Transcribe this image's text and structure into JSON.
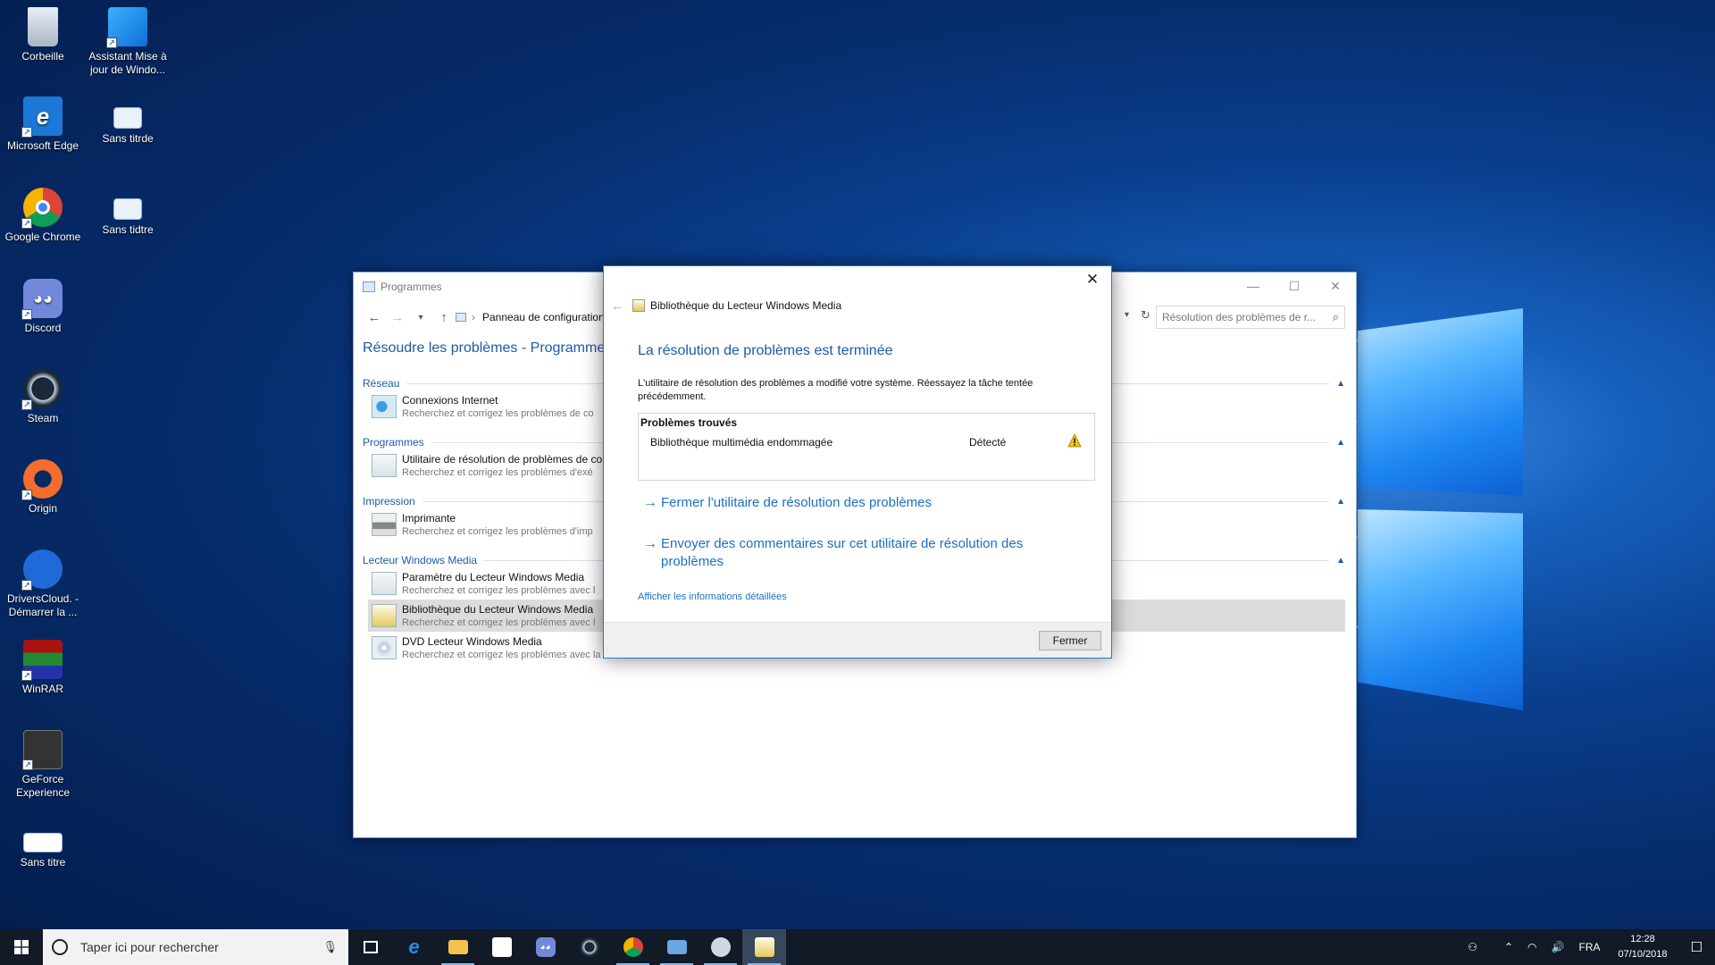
{
  "desktop": {
    "icons": [
      {
        "label": "Corbeille",
        "icon": "recycle-bin-icon"
      },
      {
        "label": "Assistant Mise à jour de Windo...",
        "icon": "windows-update-icon"
      },
      {
        "label": "Microsoft Edge",
        "icon": "edge-icon"
      },
      {
        "label": "Sans titrde",
        "icon": "image-file-icon"
      },
      {
        "label": "Google Chrome",
        "icon": "chrome-icon"
      },
      {
        "label": "Sans tidtre",
        "icon": "image-file-icon"
      },
      {
        "label": "Discord",
        "icon": "discord-icon"
      },
      {
        "label": "Steam",
        "icon": "steam-icon"
      },
      {
        "label": "Origin",
        "icon": "origin-icon"
      },
      {
        "label": "DriversCloud. - Démarrer la ...",
        "icon": "driverscloud-icon"
      },
      {
        "label": "WinRAR",
        "icon": "winrar-icon"
      },
      {
        "label": "GeForce Experience",
        "icon": "geforce-icon"
      },
      {
        "label": "Sans titre",
        "icon": "image-file-icon"
      }
    ]
  },
  "programs_window": {
    "title": "Programmes",
    "address": "Panneau de configuration",
    "search_placeholder": "Résolution des problèmes de r...",
    "heading": "Résoudre les problèmes - Programmes",
    "sections": [
      {
        "name": "Réseau",
        "items": [
          {
            "title": "Connexions Internet",
            "desc": "Recherchez et corrigez les problèmes de co"
          }
        ]
      },
      {
        "name": "Programmes",
        "items": [
          {
            "title": "Utilitaire de résolution de problèmes de cor",
            "desc": "Recherchez et corrigez les problèmes d'exé"
          }
        ]
      },
      {
        "name": "Impression",
        "items": [
          {
            "title": "Imprimante",
            "desc": "Recherchez et corrigez les problèmes d'imp"
          }
        ]
      },
      {
        "name": "Lecteur Windows Media",
        "items": [
          {
            "title": "Paramètre du Lecteur Windows Media",
            "desc": "Recherchez et corrigez les problèmes avec l"
          },
          {
            "title": "Bibliothèque du Lecteur Windows Media",
            "desc": "Recherchez et corrigez les problèmes avec l"
          },
          {
            "title": "DVD Lecteur Windows Media",
            "desc": "Recherchez et corrigez les problèmes avec la lecture de DVD dans le Lecteur Windows Media"
          }
        ]
      }
    ]
  },
  "dialog": {
    "title": "Bibliothèque du Lecteur Windows Media",
    "heading": "La résolution de problèmes est terminée",
    "description": "L'utilitaire de résolution des problèmes a modifié votre système. Réessayez la tâche tentée précédemment.",
    "problems_header": "Problèmes trouvés",
    "problem": {
      "name": "Bibliothèque multimédia endommagée",
      "status": "Détecté"
    },
    "link_close": "Fermer l'utilitaire de résolution des problèmes",
    "link_feedback": "Envoyer des commentaires sur cet utilitaire de résolution des problèmes",
    "details_link": "Afficher les informations détaillées",
    "close_button": "Fermer"
  },
  "taskbar": {
    "search_placeholder": "Taper ici pour rechercher",
    "language": "FRA",
    "time": "12:28",
    "date": "07/10/2018"
  },
  "colors": {
    "accent": "#1c6fc4",
    "heading": "#1c5aa8",
    "taskbar": "#111a26"
  }
}
